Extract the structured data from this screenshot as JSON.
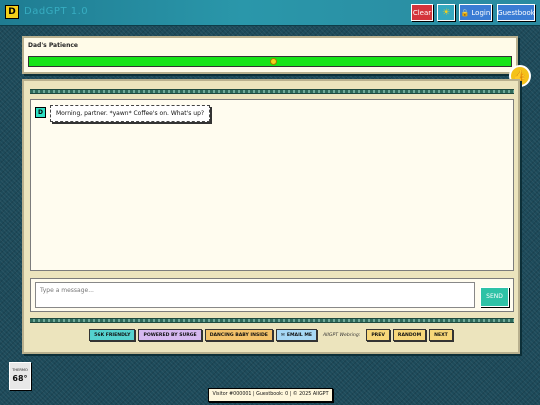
{
  "app": {
    "logo_letter": "D",
    "title": "DadGPT 1.0"
  },
  "toolbar": {
    "clear_label": "Clear",
    "sun_icon": "☀",
    "login_icon": "🔒",
    "login_label": "Login",
    "guestbook_label": "Guestbook"
  },
  "patience": {
    "label": "Dad's Patience",
    "level_percent": 100,
    "emoji": "🙂"
  },
  "corner_badge_icon": "👍",
  "chat": {
    "messages": [
      {
        "avatar": "D",
        "text": "Morning, partner. *yawn* Coffee's on. What's up?"
      }
    ]
  },
  "composer": {
    "placeholder": "Type a message...",
    "send_label": "SEND"
  },
  "badges": {
    "items": [
      "56K FRIENDLY",
      "POWERED BY SURGE",
      "DANCING BABY INSIDE"
    ],
    "email_icon": "✉",
    "email_label": "EMAIL ME",
    "webring_label": "AIIGPT Webring:",
    "prev_label": "PREV",
    "random_label": "RANDOM",
    "next_label": "NEXT"
  },
  "thermo": {
    "label": "THERMO",
    "temp": "68°"
  },
  "footer": {
    "counter_text": "Visitor #000001 | Guestbook: 0 | © 2025 AIIGPT"
  },
  "colors": {
    "accent_teal": "#2ec2a6",
    "clear_red": "#d4343c",
    "button_blue": "#3a7cd4",
    "patience_green": "#17e417",
    "logo_yellow": "#f4d01a"
  }
}
